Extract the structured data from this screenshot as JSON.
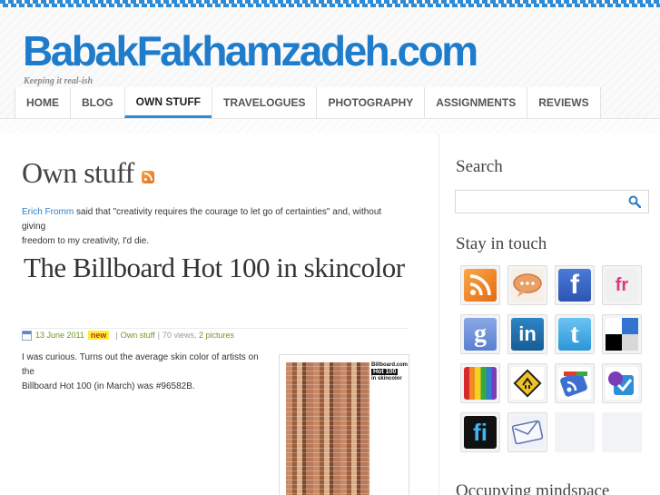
{
  "site": {
    "title": "BabakFakhamzadeh.com",
    "tagline": "Keeping it real-ish"
  },
  "nav": {
    "items": [
      {
        "label": "HOME",
        "active": false
      },
      {
        "label": "BLOG",
        "active": false
      },
      {
        "label": "OWN STUFF",
        "active": true
      },
      {
        "label": "TRAVELOGUES",
        "active": false
      },
      {
        "label": "PHOTOGRAPHY",
        "active": false
      },
      {
        "label": "ASSIGNMENTS",
        "active": false
      },
      {
        "label": "REVIEWS",
        "active": false
      }
    ]
  },
  "page": {
    "title": "Own stuff",
    "intro_link": "Erich Fromm",
    "intro_line1": " said that \"creativity requires the courage to let go of certainties\" and, without giving",
    "intro_line2": "freedom to my creativity, I'd die."
  },
  "post": {
    "title": "The Billboard Hot 100 in skincolor",
    "date": "13 June 2011",
    "badge": "new",
    "category": "Own stuff",
    "views": "70 views,",
    "pictures": "2 pictures",
    "body_line1": "I was curious. Turns out the average skin color of artists on the",
    "body_line2": "Billboard Hot 100 (in March) was #96582B.",
    "thumb_logo_top": "Billboard.com",
    "thumb_logo_hot": "Hot 100",
    "thumb_logo_sub": "in skincolor"
  },
  "sidebar": {
    "search_heading": "Search",
    "search_placeholder": "",
    "stay_heading": "Stay in touch",
    "occupying_heading": "Occupying mindspace"
  },
  "social": [
    {
      "name": "rss-icon",
      "color": "#f08a24",
      "glyph": ""
    },
    {
      "name": "chat-icon",
      "color": "#e9a66b",
      "glyph": ""
    },
    {
      "name": "facebook-icon",
      "color": "#3b66c4",
      "glyph": "f"
    },
    {
      "name": "flickr-icon",
      "color": "#f0f0f0",
      "glyph": "fr"
    },
    {
      "name": "google-icon",
      "color": "#6a8fd8",
      "glyph": "g"
    },
    {
      "name": "linkedin-icon",
      "color": "#1f6fae",
      "glyph": "in"
    },
    {
      "name": "twitter-icon",
      "color": "#3fa7e6",
      "glyph": "t"
    },
    {
      "name": "delicious-icon",
      "color": "#ffffff",
      "glyph": ""
    },
    {
      "name": "stripes-icon",
      "color": "#d33",
      "glyph": ""
    },
    {
      "name": "sign-icon",
      "color": "#f4c21f",
      "glyph": ""
    },
    {
      "name": "google-reader-icon",
      "color": "#4a78d0",
      "glyph": ""
    },
    {
      "name": "foursquare-icon",
      "color": "#2c8fd8",
      "glyph": ""
    },
    {
      "name": "friendfeed-icon",
      "color": "#111111",
      "glyph": "fi"
    },
    {
      "name": "email-icon",
      "color": "#e8eef7",
      "glyph": ""
    }
  ]
}
